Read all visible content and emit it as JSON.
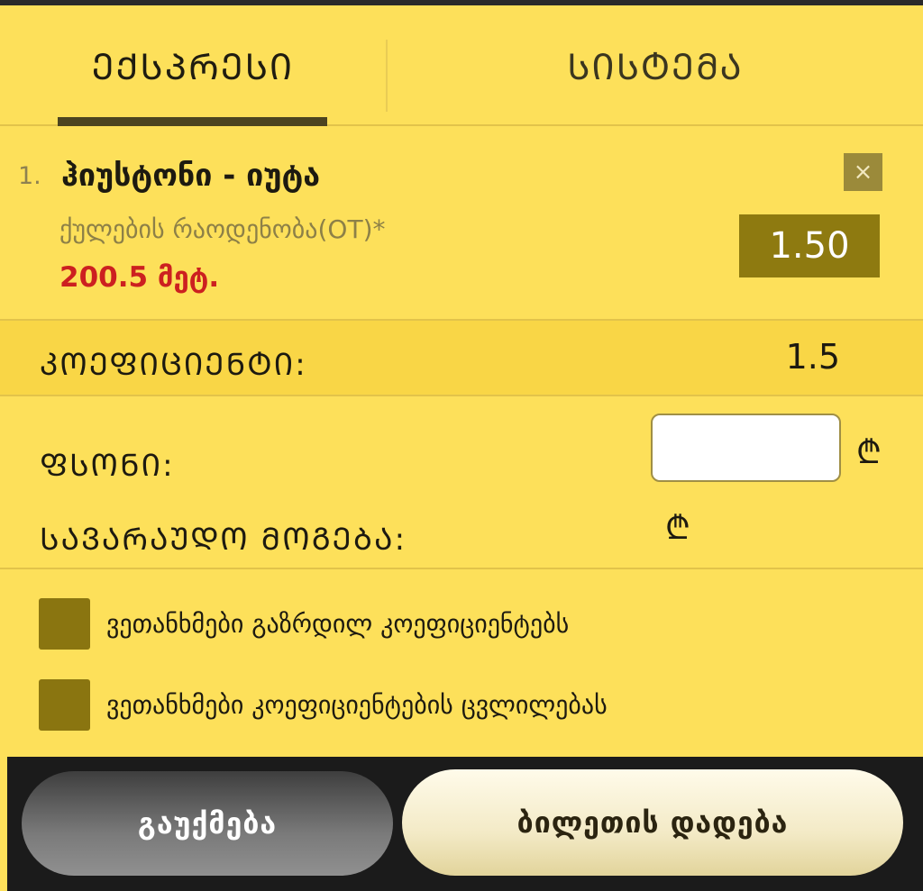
{
  "tabs": [
    {
      "label": "ᲔᲥᲡᲞᲠᲔᲡᲘ",
      "active": true
    },
    {
      "label": "ᲡᲘᲡᲢᲔᲛᲐ",
      "active": false
    }
  ],
  "bet": {
    "index": "1.",
    "title": "ჰიუსტონი - იუტა",
    "market": "ქულების რაოდენობა(OT)*",
    "selection": "200.5 მეტ.",
    "odds": "1.50",
    "close_icon": "×"
  },
  "coefficient": {
    "label": "ᲙᲝᲔᲤᲘᲪᲘᲔᲜᲢᲘ:",
    "value": "1.5"
  },
  "stake": {
    "label": "ᲤᲡᲝᲜᲘ:",
    "value": "",
    "currency": "₾"
  },
  "potential_win": {
    "label": "ᲡᲐᲕᲐᲠᲐᲣᲓᲝ ᲛᲝᲒᲔᲑᲐ:",
    "currency": "₾"
  },
  "checkboxes": [
    {
      "label": "ვეთანხმები გაზრდილ კოეფიციენტებს",
      "checked": false
    },
    {
      "label": "ვეთანხმები კოეფიციენტების ცვლილებას",
      "checked": false
    }
  ],
  "buttons": {
    "cancel": "გაუქმება",
    "place": "ბილეთის დადება"
  },
  "colors": {
    "background": "#fde05a",
    "accent_dark": "#8e7a10",
    "selection_red": "#cc2020"
  }
}
